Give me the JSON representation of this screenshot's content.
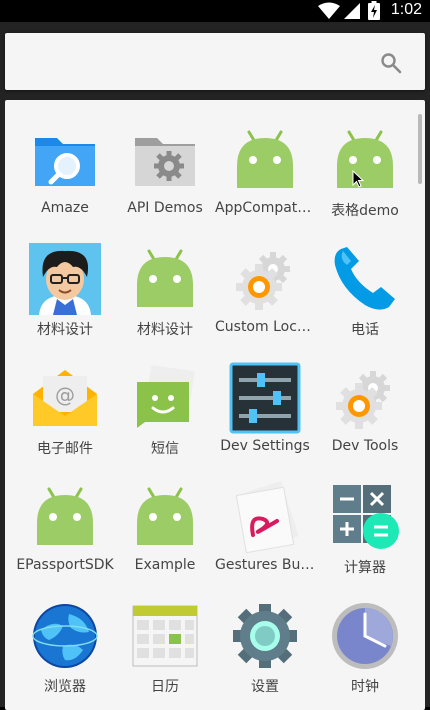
{
  "status_bar": {
    "time": "1:02"
  },
  "search": {
    "placeholder": ""
  },
  "apps": [
    {
      "label": "Amaze",
      "icon": "folder-search-icon"
    },
    {
      "label": "API Demos",
      "icon": "folder-gear-icon"
    },
    {
      "label": "AppCompatOne",
      "icon": "android-robot-icon"
    },
    {
      "label": "表格demo",
      "icon": "android-robot-icon"
    },
    {
      "label": "材料设计",
      "icon": "cartoon-avatar-icon"
    },
    {
      "label": "材料设计",
      "icon": "android-robot-icon"
    },
    {
      "label": "Custom Locale",
      "icon": "orange-gear-icon"
    },
    {
      "label": "电话",
      "icon": "phone-handset-icon"
    },
    {
      "label": "电子邮件",
      "icon": "email-envelope-icon"
    },
    {
      "label": "短信",
      "icon": "sms-message-icon"
    },
    {
      "label": "Dev Settings",
      "icon": "sliders-icon"
    },
    {
      "label": "Dev Tools",
      "icon": "orange-gear-icon"
    },
    {
      "label": "EPassportSDK",
      "icon": "android-robot-icon"
    },
    {
      "label": "Example",
      "icon": "android-robot-icon"
    },
    {
      "label": "Gestures Build…",
      "icon": "gesture-card-icon"
    },
    {
      "label": "计算器",
      "icon": "calculator-icon"
    },
    {
      "label": "浏览器",
      "icon": "globe-browser-icon"
    },
    {
      "label": "日历",
      "icon": "calendar-grid-icon"
    },
    {
      "label": "设置",
      "icon": "settings-gear-icon"
    },
    {
      "label": "时钟",
      "icon": "clock-icon"
    }
  ]
}
